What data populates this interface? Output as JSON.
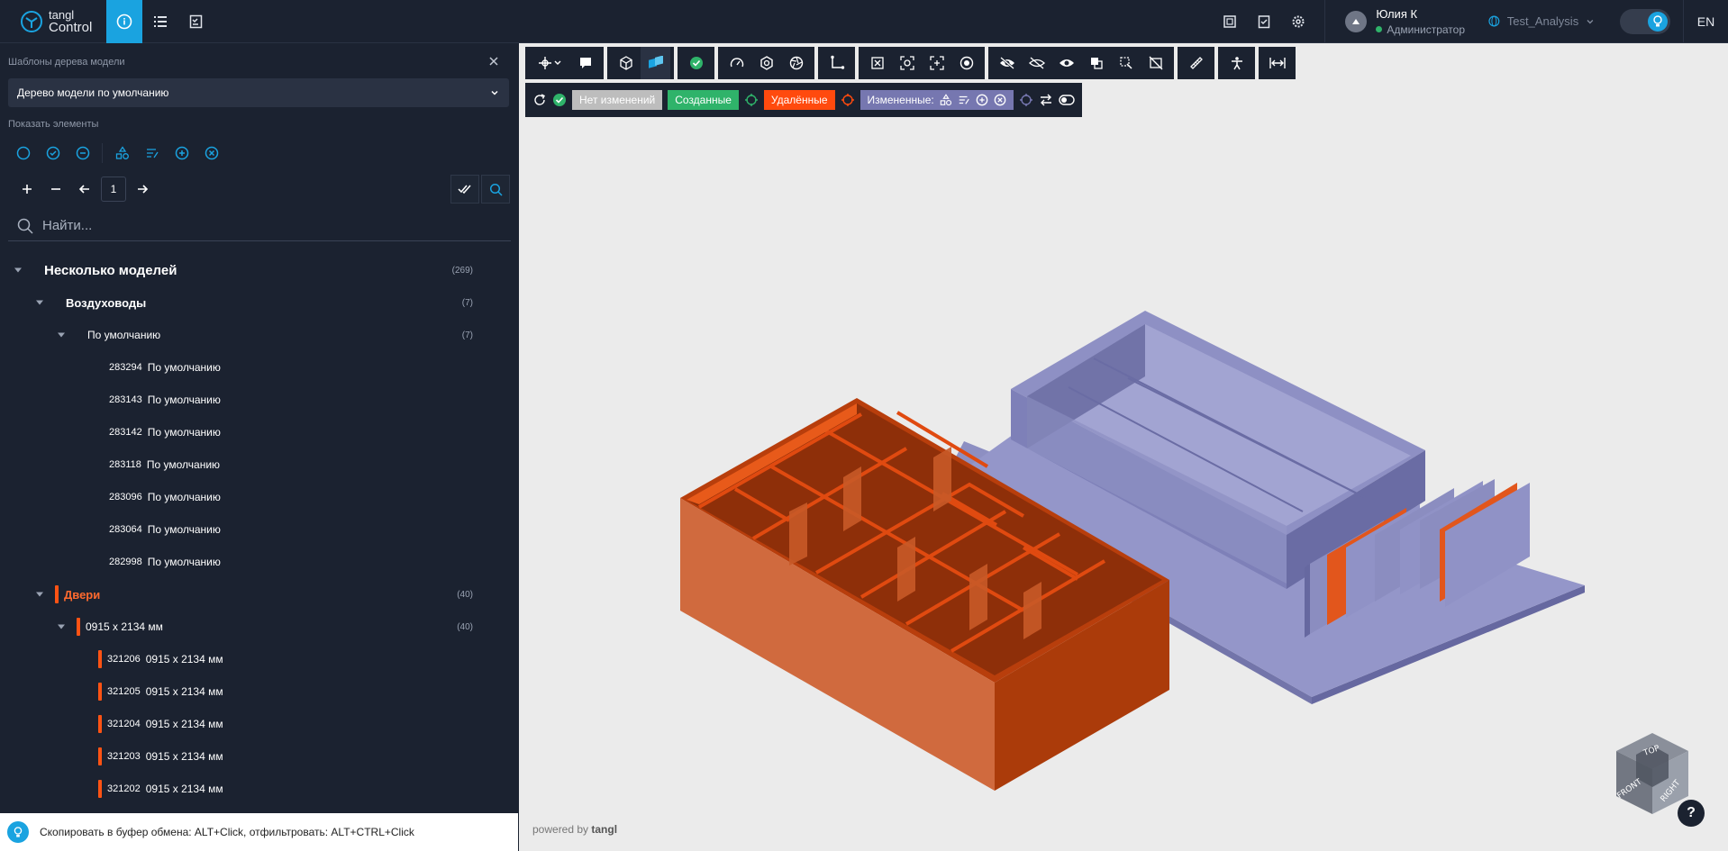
{
  "app": {
    "logo_line1": "tangl",
    "logo_line2": "Control"
  },
  "header": {
    "user_name": "Юлия К",
    "user_role": "Администратор",
    "project": "Test_Analysis",
    "lang": "EN"
  },
  "left_panel": {
    "templates_label": "Шаблоны дерева модели",
    "template_selected": "Дерево модели по умолчанию",
    "show_elements_label": "Показать элементы",
    "page_number": "1",
    "search_placeholder": "Найти..."
  },
  "tree": {
    "root": {
      "label": "Несколько моделей",
      "count": "(269)"
    },
    "group1": {
      "label": "Воздуховоды",
      "count": "(7)"
    },
    "group1_sub": {
      "label": "По умолчанию",
      "count": "(7)"
    },
    "group1_items": [
      {
        "id": "283294",
        "label": "По умолчанию"
      },
      {
        "id": "283143",
        "label": "По умолчанию"
      },
      {
        "id": "283142",
        "label": "По умолчанию"
      },
      {
        "id": "283118",
        "label": "По умолчанию"
      },
      {
        "id": "283096",
        "label": "По умолчанию"
      },
      {
        "id": "283064",
        "label": "По умолчанию"
      },
      {
        "id": "282998",
        "label": "По умолчанию"
      }
    ],
    "group2": {
      "label": "Двери",
      "count": "(40)"
    },
    "group2_sub": {
      "label": "0915 x 2134 мм",
      "count": "(40)"
    },
    "group2_items": [
      {
        "id": "321206",
        "label": "0915 x 2134 мм"
      },
      {
        "id": "321205",
        "label": "0915 x 2134 мм"
      },
      {
        "id": "321204",
        "label": "0915 x 2134 мм"
      },
      {
        "id": "321203",
        "label": "0915 x 2134 мм"
      },
      {
        "id": "321202",
        "label": "0915 x 2134 мм"
      }
    ]
  },
  "hint": {
    "text": "Скопировать в буфер обмена: ALT+Click, отфильтровать: ALT+CTRL+Click"
  },
  "viewport": {
    "pill_none": "Нет изменений",
    "pill_created": "Созданные",
    "pill_deleted": "Удалённые",
    "pill_changed": "Измененные:",
    "powered_prefix": "powered by",
    "powered_brand": "tangl",
    "cube_top": "TOP",
    "cube_front": "FRONT",
    "cube_right": "RIGHT",
    "help": "?"
  },
  "colors": {
    "accent": "#1aa3e0",
    "deleted": "#ff4a0e",
    "created": "#2fb36a",
    "changed": "#7677b0",
    "panel_bg": "#1b2230",
    "viewport_bg": "#ebebeb"
  }
}
